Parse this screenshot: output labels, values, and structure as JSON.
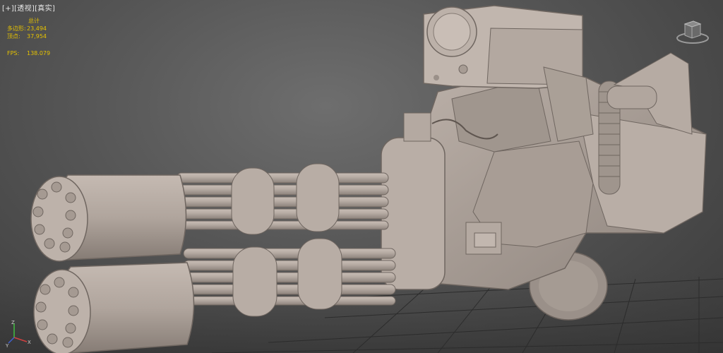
{
  "viewport": {
    "label": "[+][透视][真实]"
  },
  "stats": {
    "title": "总计",
    "polygons_label": "多边形:",
    "polygons_value": "23,494",
    "vertices_label": "顶点:",
    "vertices_value": "37,954",
    "fps_label": "FPS:",
    "fps_value": "138.079"
  },
  "axis": {
    "x": "X",
    "y": "Y",
    "z": "Z"
  },
  "colors": {
    "background": "#555555",
    "stats_text": "#e6c200",
    "label_text": "#e8e8e8",
    "model": "#b3a8a0",
    "grid": "#2a2a2a"
  },
  "icons": [
    "viewcube-icon",
    "axis-tripod-icon"
  ]
}
